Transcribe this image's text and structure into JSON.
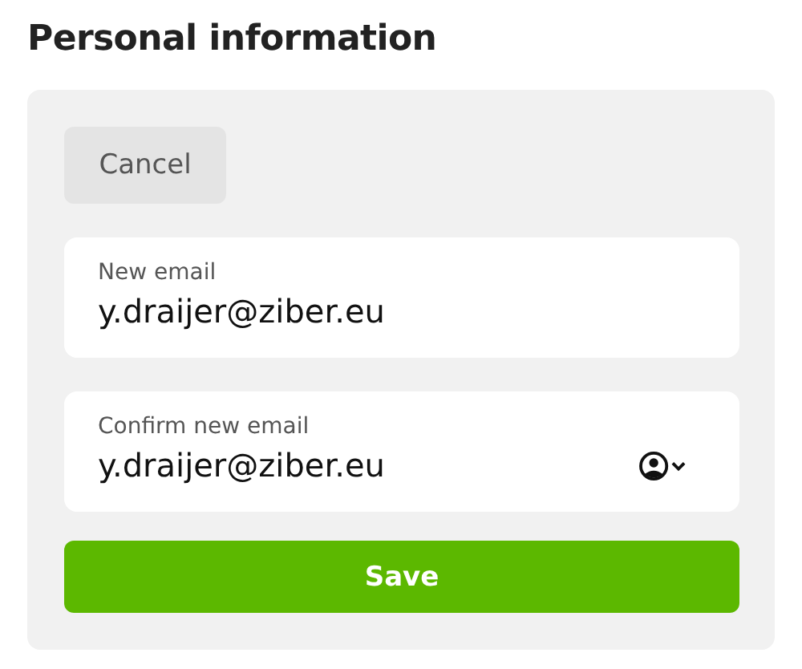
{
  "title": "Personal information",
  "cancel_button": "Cancel",
  "fields": [
    {
      "kind": "text",
      "label": "New email",
      "value": "y.draijer@ziber.eu"
    },
    {
      "kind": "autofill",
      "label": "Confirm new email",
      "value": "y.draijer@ziber.eu"
    }
  ],
  "save_button": "Save"
}
